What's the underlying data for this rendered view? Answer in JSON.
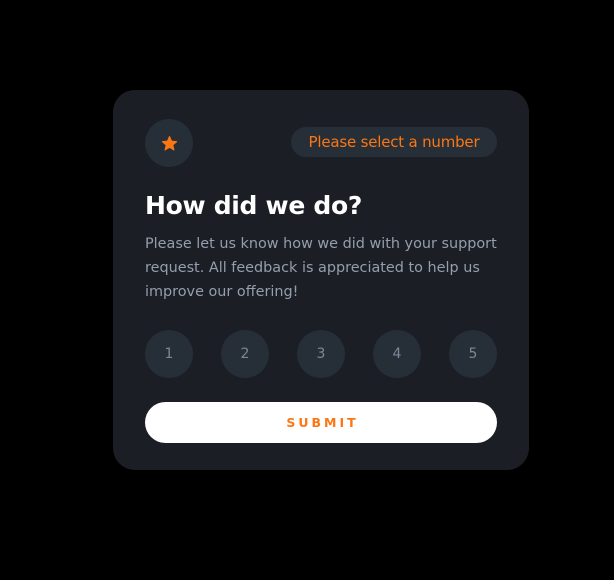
{
  "colors": {
    "page_background": "#000000",
    "card_background": "#1b1f25",
    "chip_background": "#262e38",
    "accent_orange": "#fc7614",
    "heading_text": "#ffffff",
    "body_text": "#959eac",
    "rating_text": "#7c8798",
    "submit_background": "#ffffff"
  },
  "card": {
    "icon": "star-icon",
    "status_message": "Please select a number",
    "title": "How did we do?",
    "description": "Please let us know how we did with your support request. All feedback is appreciated to help us improve our offering!",
    "ratings": [
      "1",
      "2",
      "3",
      "4",
      "5"
    ],
    "submit_label": "SUBMIT"
  }
}
